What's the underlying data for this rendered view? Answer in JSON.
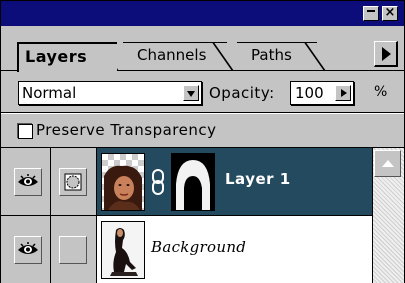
{
  "tabs": [
    {
      "label": "Layers",
      "active": true
    },
    {
      "label": "Channels",
      "active": false
    },
    {
      "label": "Paths",
      "active": false
    }
  ],
  "blend_mode": {
    "selected": "Normal"
  },
  "opacity": {
    "label": "Opacity:",
    "value": "100",
    "unit": "%"
  },
  "preserve_transparency": {
    "label": "Preserve Transparency",
    "checked": false
  },
  "layers": [
    {
      "name": "Layer 1",
      "selected": true,
      "visible": true,
      "has_mask": true,
      "linked": true
    },
    {
      "name": "Background",
      "selected": false,
      "visible": true,
      "has_mask": false,
      "linked": false
    }
  ],
  "colors": {
    "title_bar": "#0c0c7a",
    "selected_row": "#234a5e",
    "panel": "#c4c4c4"
  },
  "icons": {
    "eye": "eye-icon",
    "mask": "layer-mask-icon",
    "link": "chain-link-icon",
    "menu": "triangle-right-icon",
    "close": "close-icon",
    "minimize": "minimize-icon"
  }
}
